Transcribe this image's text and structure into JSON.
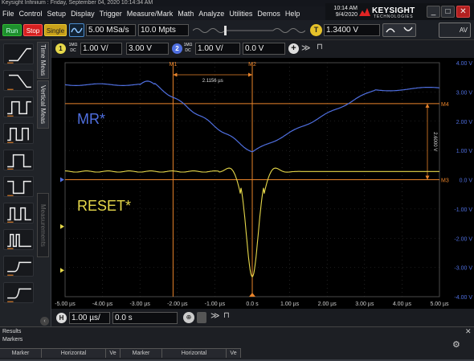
{
  "title_bar": {
    "text": "Keysight Infiniium : Friday, September 04, 2020 10:14:34 AM"
  },
  "menu": [
    "File",
    "Control",
    "Setup",
    "Display",
    "Trigger",
    "Measure/Mark",
    "Math",
    "Analyze",
    "Utilities",
    "Demos",
    "Help"
  ],
  "clock": {
    "time": "10:14 AM",
    "date": "9/4/2020"
  },
  "brand": {
    "name": "KEYSIGHT",
    "sub": "TECHNOLOGIES",
    "logo_color": "#e02424"
  },
  "window_buttons": {
    "minimize": "_",
    "maximize": "□",
    "close": "✕"
  },
  "control": {
    "run": "Run",
    "stop": "Stop",
    "single": "Single",
    "sample_rate": "5.00 MSa/s",
    "memory_depth": "10.0 Mpts",
    "trigger_icon": "T",
    "trigger_level": "1.3400 V",
    "autoscale_label": "AV"
  },
  "left_tabs": {
    "time_meas": "Time Meas",
    "vertical_meas": "Vertical Meas",
    "measurements": "Measurements"
  },
  "measurement_icons": [
    "rise-time-icon",
    "fall-time-icon",
    "period-icon",
    "frequency-icon",
    "pos-width-icon",
    "neg-width-icon",
    "duty-cycle-icon",
    "burst-icon",
    "setup-time-icon",
    "hold-time-icon"
  ],
  "channels": {
    "ch1": {
      "num": "1",
      "impedance": "1MΩ",
      "coupling": "DC",
      "scale": "1.00 V/",
      "offset": "3.00 V",
      "color": "#e6d84a"
    },
    "ch2": {
      "num": "2",
      "impedance": "1MΩ",
      "coupling": "DC",
      "scale": "1.00 V/",
      "offset": "0.0 V",
      "color": "#4f6fe0"
    }
  },
  "horizontal": {
    "badge": "H",
    "scale": "1.00 µs/",
    "position": "0.0 s"
  },
  "colors": {
    "ch1": "#e6d84a",
    "ch2": "#4f6fe0",
    "marker": "#e8832a",
    "grid": "#3a3a3a",
    "axis_label": "#4f6fe0"
  },
  "scope": {
    "y_axis_labels": [
      "4.00 V",
      "3.00 V",
      "2.00 V",
      "1.00 V",
      "0.0 V",
      "-1.00 V",
      "-2.00 V",
      "-3.00 V",
      "-4.00 V"
    ],
    "x_axis_labels": [
      "-5.00 µs",
      "-4.00 µs",
      "-3.00 µs",
      "-2.00 µs",
      "-1.00 µs",
      "0.0 s",
      "1.00 µs",
      "2.00 µs",
      "3.00 µs",
      "4.00 µs",
      "5.00 µs"
    ],
    "trace_labels": {
      "ch2": "MR*",
      "ch1": "RESET*"
    },
    "markers": {
      "m1": "M1",
      "m2": "M2",
      "m3": "M3",
      "m4": "M4"
    },
    "delta_time": "2.1156 µs",
    "delta_voltage": "2.6000 V"
  },
  "results": {
    "title": "Results",
    "tab": "Markers",
    "columns": [
      "Marker",
      "Horizontal",
      "Ve",
      "Marker",
      "Horizontal",
      "Ve"
    ]
  }
}
